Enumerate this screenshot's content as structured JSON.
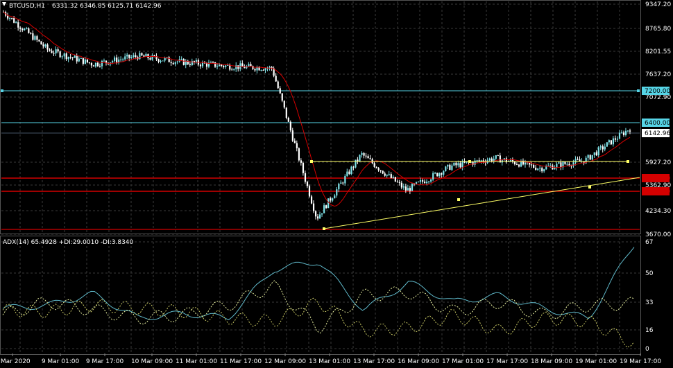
{
  "header": {
    "symbol": "BTCUSD,H1",
    "ohlc": "6331.32 6346.85 6125.71 6142.96"
  },
  "price_axis": {
    "labels": [
      "9347.20",
      "8765.80",
      "8201.55",
      "7637.20",
      "7072.90",
      "5927.20",
      "5362.90",
      "4234.30",
      "3670.00"
    ],
    "level_tags": [
      {
        "text": "7200.00",
        "color": "#56d4e6",
        "text_color": "#000000"
      },
      {
        "text": "6400.00",
        "color": "#56d4e6",
        "text_color": "#000000"
      },
      {
        "text": "6142.96",
        "color": "#ffffff",
        "text_color": "#000000"
      },
      {
        "text": "5500.00",
        "color": "#d40000",
        "text_color": "#d40000"
      },
      {
        "text": "4800.00",
        "color": "#d40000",
        "text_color": "#d40000"
      }
    ]
  },
  "indicator": {
    "header": "ADX(14) 65.4928 +DI:29.0010 -DI:3.8340",
    "axis_labels": [
      "67",
      "50",
      "33",
      "16",
      "0"
    ]
  },
  "time_axis": {
    "labels": [
      "6 Mar 2020",
      "9 Mar 01:00",
      "9 Mar 17:00",
      "10 Mar 09:00",
      "11 Mar 01:00",
      "11 Mar 17:00",
      "12 Mar 09:00",
      "13 Mar 01:00",
      "13 Mar 17:00",
      "16 Mar 09:00",
      "17 Mar 01:00",
      "17 Mar 17:00",
      "18 Mar 09:00",
      "19 Mar 01:00",
      "19 Mar 17:00"
    ]
  },
  "colors": {
    "background": "#000000",
    "grid": "#3a3a3a",
    "candle_up": "#7fe3e8",
    "candle_down": "#ffffff",
    "moving_average": "#d40000",
    "trendline": "#ffff66",
    "adx_line": "#5fb8c9",
    "plus_di": "#e8f0a0",
    "minus_di": "#cccc66"
  },
  "chart_data": [
    {
      "type": "line",
      "title": "BTCUSD,H1",
      "ylim": [
        3670.0,
        9347.2
      ],
      "x": [
        "6 Mar 2020",
        "9 Mar 01:00",
        "9 Mar 17:00",
        "10 Mar 09:00",
        "11 Mar 01:00",
        "11 Mar 17:00",
        "12 Mar 09:00",
        "13 Mar 01:00",
        "13 Mar 17:00",
        "16 Mar 09:00",
        "17 Mar 01:00",
        "17 Mar 17:00",
        "18 Mar 09:00",
        "19 Mar 01:00",
        "19 Mar 17:00"
      ],
      "series": [
        {
          "name": "BTCUSD,H1",
          "values": [
            9150,
            8200,
            7850,
            8050,
            7900,
            7800,
            7750,
            4000,
            5600,
            4700,
            5300,
            5500,
            5250,
            5450,
            6250
          ]
        }
      ],
      "horizontal_levels": [
        7200.0,
        6400.0,
        6142.96,
        5500.0,
        4800.0,
        5927.2,
        3670.0
      ]
    },
    {
      "type": "line",
      "title": "ADX(14) 65.4928 +DI:29.0010 -DI:3.8340",
      "ylim": [
        0,
        67
      ],
      "x": [
        "6 Mar 2020",
        "9 Mar 01:00",
        "9 Mar 17:00",
        "10 Mar 09:00",
        "11 Mar 01:00",
        "11 Mar 17:00",
        "12 Mar 09:00",
        "13 Mar 01:00",
        "13 Mar 17:00",
        "16 Mar 09:00",
        "17 Mar 01:00",
        "17 Mar 17:00",
        "18 Mar 09:00",
        "19 Mar 01:00",
        "19 Mar 17:00"
      ],
      "series": [
        {
          "name": "ADX(14)",
          "values": [
            26,
            28,
            35,
            20,
            23,
            20,
            50,
            55,
            25,
            42,
            30,
            34,
            26,
            20,
            65.49
          ]
        },
        {
          "name": "+DI",
          "values": [
            22,
            30,
            25,
            20,
            22,
            28,
            40,
            14,
            34,
            36,
            24,
            30,
            22,
            28,
            29.0
          ]
        },
        {
          "name": "-DI",
          "values": [
            25,
            24,
            28,
            26,
            24,
            20,
            18,
            30,
            12,
            14,
            22,
            12,
            20,
            18,
            3.83
          ]
        }
      ]
    }
  ]
}
